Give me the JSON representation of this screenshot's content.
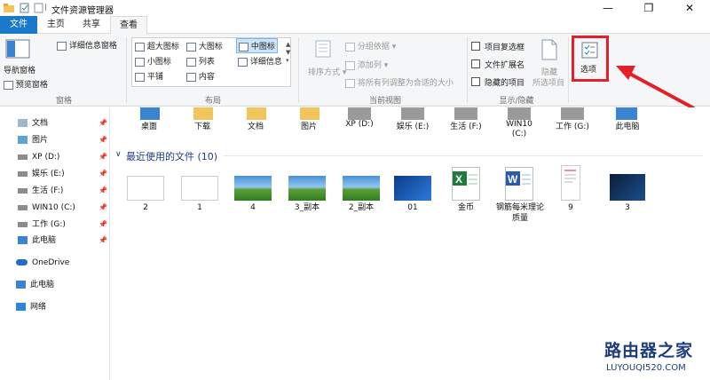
{
  "window": {
    "title": "文件资源管理器",
    "minimize": "—",
    "maximize": "❐",
    "close": "✕"
  },
  "tabs": {
    "file": "文件",
    "home": "主页",
    "share": "共享",
    "view": "查看"
  },
  "ribbon": {
    "panes": {
      "label": "窗格",
      "nav_pane": "导航窗格",
      "preview_pane": "预览窗格",
      "details_pane": "详细信息窗格"
    },
    "layout": {
      "label": "布局",
      "extra_large": "超大图标",
      "large": "大图标",
      "medium": "中图标",
      "small": "小图标",
      "list": "列表",
      "details": "详细信息",
      "tiles": "平铺",
      "content": "内容"
    },
    "current_view": {
      "label": "当前视图",
      "sort_by": "排序方式",
      "group_by": "分组依据",
      "add_columns": "添加列",
      "size_all": "将所有列调整为合适的大小"
    },
    "show_hide": {
      "label": "显示/隐藏",
      "item_checkboxes": "项目复选框",
      "file_extensions": "文件扩展名",
      "hidden_items": "隐藏的项目",
      "hide_selected": "隐藏",
      "selected_items": "所选项目"
    },
    "options": "选项"
  },
  "nav": {
    "quick": [
      "文档",
      "图片",
      "XP (D:)",
      "娱乐 (E:)",
      "生活 (F:)",
      "WIN10 (C:)",
      "工作 (G:)",
      "此电脑"
    ],
    "onedrive": "OneDrive",
    "this_pc": "此电脑",
    "network": "网络"
  },
  "frequent": [
    "桌面",
    "下载",
    "文档",
    "图片",
    "XP (D:)",
    "娱乐 (E:)",
    "生活 (F:)",
    "WIN10\n(C:)",
    "工作 (G:)",
    "此电脑"
  ],
  "recent": {
    "header": "最近使用的文件 (10)",
    "files": [
      "2",
      "1",
      "4",
      "3_副本",
      "2_副本",
      "01",
      "金币",
      "钢筋每米理论质量",
      "9",
      "3"
    ]
  },
  "watermark": {
    "cn": "路由器之家",
    "en": "LUYOUQI520.COM"
  },
  "colors": {
    "accent": "#1979ca",
    "highlight": "#e3202a"
  }
}
